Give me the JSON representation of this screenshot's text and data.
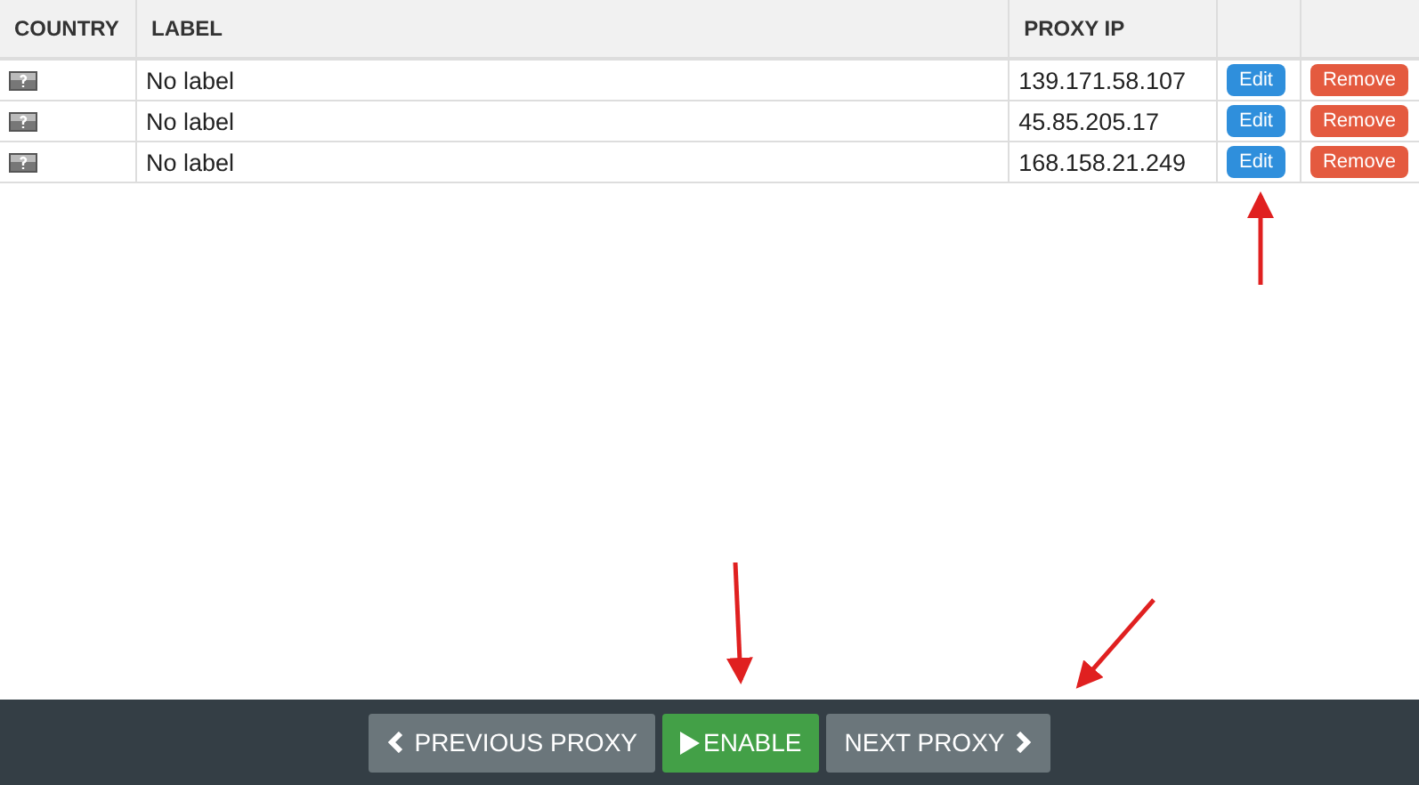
{
  "table": {
    "columns": [
      "COUNTRY",
      "LABEL",
      "PROXY IP"
    ],
    "rows": [
      {
        "label": "No label",
        "proxy_ip": "139.171.58.107",
        "edit": "Edit",
        "remove": "Remove"
      },
      {
        "label": "No label",
        "proxy_ip": "45.85.205.17",
        "edit": "Edit",
        "remove": "Remove"
      },
      {
        "label": "No label",
        "proxy_ip": "168.158.21.249",
        "edit": "Edit",
        "remove": "Remove"
      }
    ]
  },
  "footer": {
    "buttons": [
      {
        "kind": "previous",
        "label": "PREVIOUS PROXY"
      },
      {
        "kind": "enable",
        "label": "ENABLE"
      },
      {
        "kind": "next",
        "label": "NEXT PROXY"
      }
    ]
  }
}
